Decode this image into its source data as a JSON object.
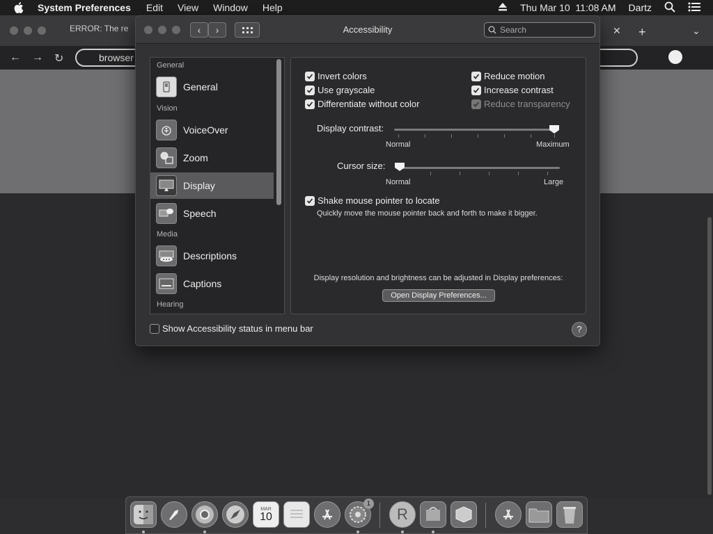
{
  "menubar": {
    "app_name": "System Preferences",
    "menus": [
      "Edit",
      "View",
      "Window",
      "Help"
    ],
    "clock": "Thu Mar 10  11:08 AM",
    "user": "Dartz"
  },
  "browser": {
    "tab_title": "ERROR: The re",
    "url_text": "browser"
  },
  "window": {
    "title": "Accessibility",
    "search_placeholder": "Search"
  },
  "sidebar": {
    "sections": {
      "general": "General",
      "vision": "Vision",
      "media": "Media",
      "hearing": "Hearing"
    },
    "items": [
      {
        "label": "General",
        "icon": "switch-icon"
      },
      {
        "label": "VoiceOver",
        "icon": "voiceover-icon"
      },
      {
        "label": "Zoom",
        "icon": "zoom-icon"
      },
      {
        "label": "Display",
        "icon": "display-icon",
        "selected": true
      },
      {
        "label": "Speech",
        "icon": "speech-icon"
      },
      {
        "label": "Descriptions",
        "icon": "descriptions-icon"
      },
      {
        "label": "Captions",
        "icon": "captions-icon"
      }
    ]
  },
  "display": {
    "checkboxes_left": [
      {
        "label": "Invert colors",
        "checked": true
      },
      {
        "label": "Use grayscale",
        "checked": true
      },
      {
        "label": "Differentiate without color",
        "checked": true
      }
    ],
    "checkboxes_right": [
      {
        "label": "Reduce motion",
        "checked": true
      },
      {
        "label": "Increase contrast",
        "checked": true
      },
      {
        "label": "Reduce transparency",
        "checked": true,
        "disabled": true
      }
    ],
    "contrast": {
      "label": "Display contrast:",
      "min_label": "Normal",
      "max_label": "Maximum",
      "value": 1.0
    },
    "cursor": {
      "label": "Cursor size:",
      "min_label": "Normal",
      "max_label": "Large",
      "value": 0.0
    },
    "shake": {
      "label": "Shake mouse pointer to locate",
      "checked": true,
      "description": "Quickly move the mouse pointer back and forth to make it bigger."
    },
    "resolution_note": "Display resolution and brightness can be adjusted in Display preferences:",
    "open_button": "Open Display Preferences..."
  },
  "footer": {
    "status_checkbox": "Show Accessibility status in menu bar",
    "status_checked": false,
    "help": "?"
  },
  "dock": {
    "calendar_month": "MAR",
    "calendar_day": "10",
    "badge": "1",
    "r_letter": "R"
  }
}
